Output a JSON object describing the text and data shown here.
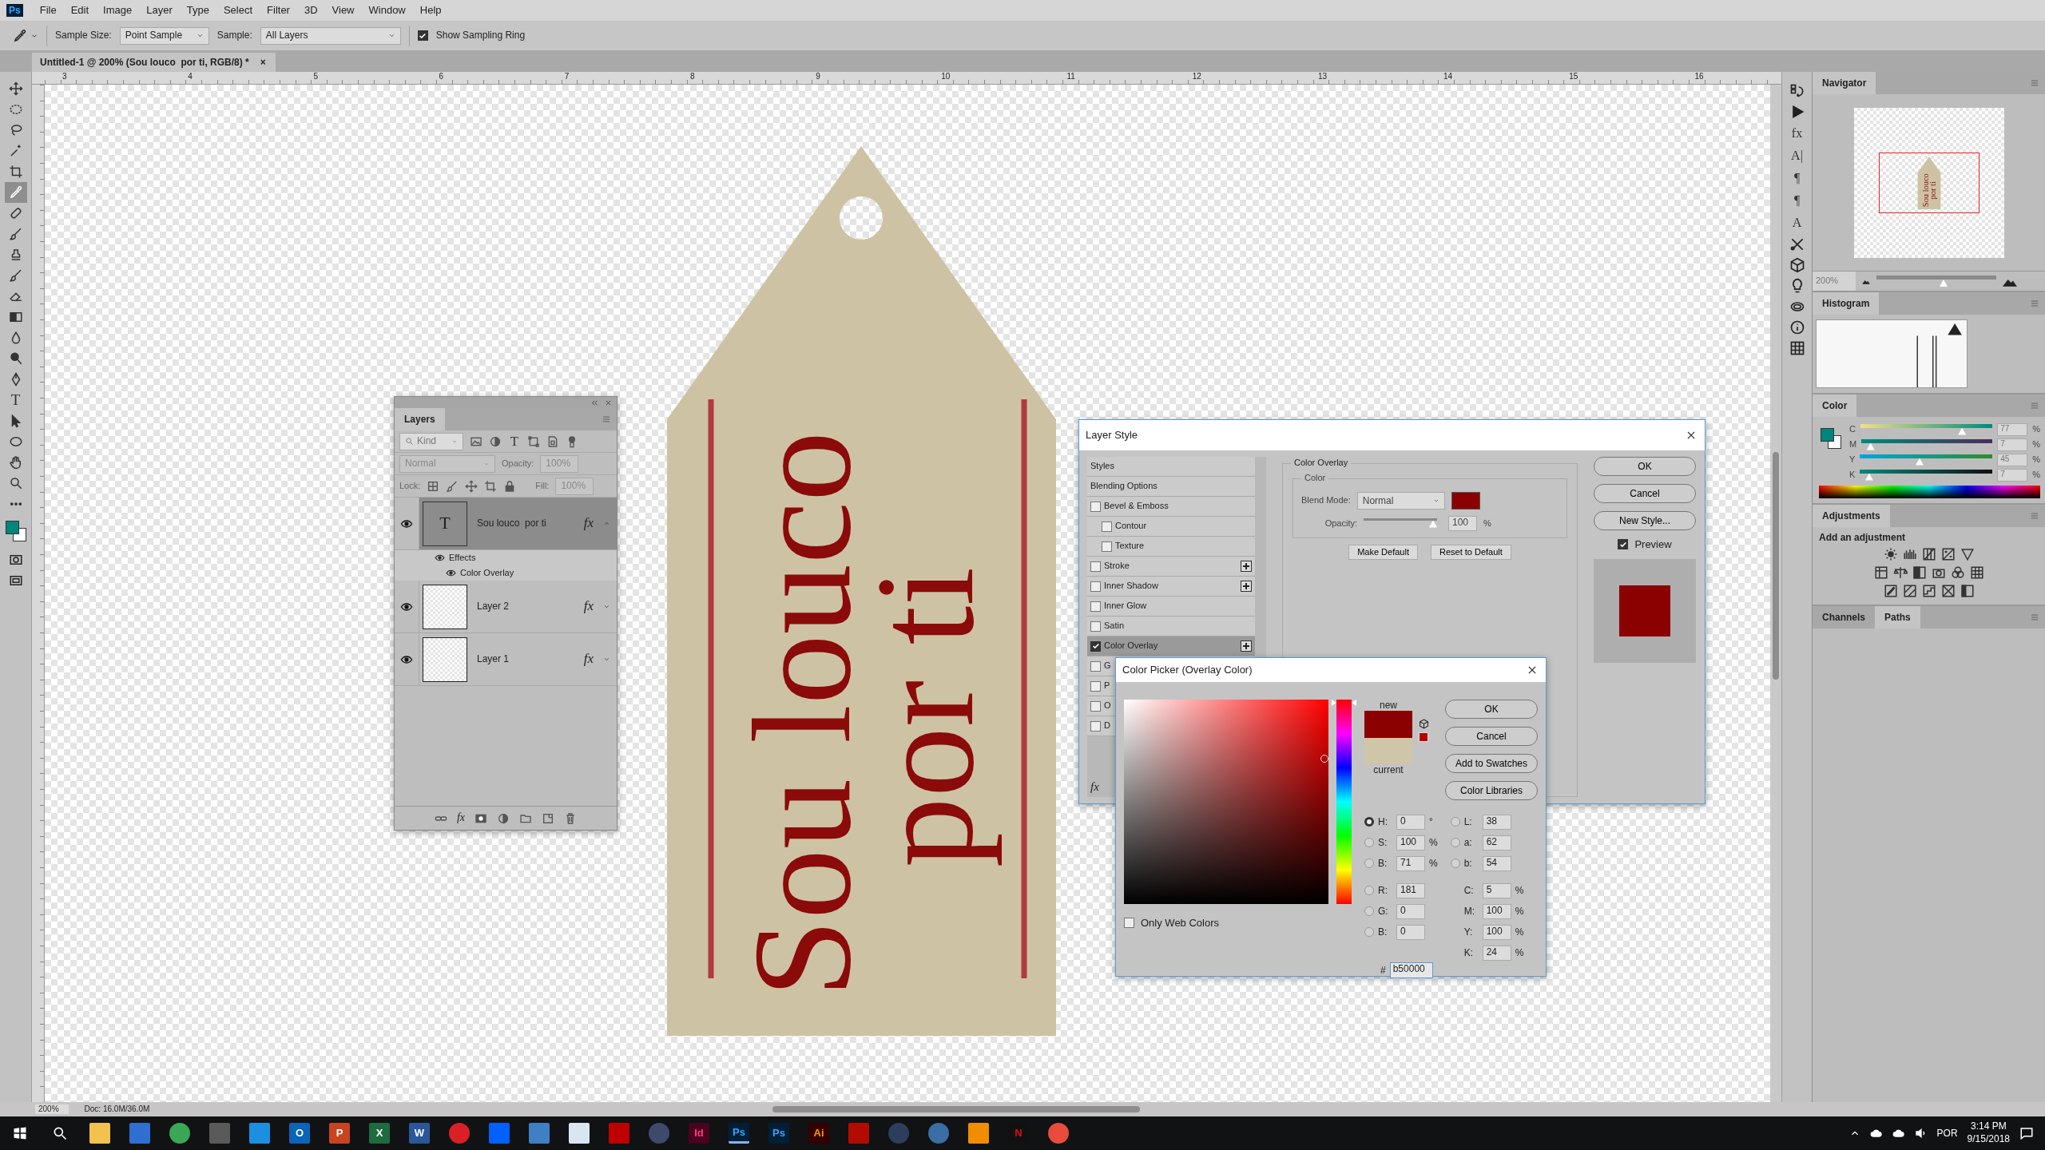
{
  "app_logo": "Ps",
  "menu": [
    "File",
    "Edit",
    "Image",
    "Layer",
    "Type",
    "Select",
    "Filter",
    "3D",
    "View",
    "Window",
    "Help"
  ],
  "options_bar": {
    "sample_size_label": "Sample Size:",
    "sample_size": "Point Sample",
    "sample_label": "Sample:",
    "sample": "All Layers",
    "sampling_ring": {
      "label": "Show Sampling Ring",
      "checked": true
    }
  },
  "document_tab": {
    "title": "Untitled-1 @ 200% (Sou louco  por ti, RGB/8) *",
    "close": "×"
  },
  "ruler_marks": [
    "3",
    "4",
    "5",
    "6",
    "7",
    "8",
    "9",
    "10",
    "11",
    "12",
    "13",
    "14",
    "15",
    "16"
  ],
  "tools": [
    {
      "kind": "move",
      "selected": false
    },
    {
      "kind": "marquee",
      "selected": false
    },
    {
      "kind": "lasso",
      "selected": false
    },
    {
      "kind": "wand",
      "selected": false
    },
    {
      "kind": "crop",
      "selected": false
    },
    {
      "kind": "eyedropper",
      "selected": true
    },
    {
      "kind": "heal",
      "selected": false
    },
    {
      "kind": "brush",
      "selected": false
    },
    {
      "kind": "stamp",
      "selected": false
    },
    {
      "kind": "brush",
      "selected": false
    },
    {
      "kind": "eraser",
      "selected": false
    },
    {
      "kind": "gradient",
      "selected": false
    },
    {
      "kind": "blur",
      "selected": false
    },
    {
      "kind": "dodge",
      "selected": false
    },
    {
      "kind": "pen",
      "selected": false
    },
    {
      "kind": "type",
      "glyph": "T",
      "selected": false
    },
    {
      "kind": "pathsel",
      "selected": false
    },
    {
      "kind": "shape",
      "selected": false
    },
    {
      "kind": "hand",
      "selected": false
    },
    {
      "kind": "zoom",
      "selected": false
    },
    {
      "kind": "more",
      "selected": false
    }
  ],
  "canvas": {
    "tag_lines": [
      "Sou louco",
      "por ti"
    ]
  },
  "status_bar": {
    "zoom": "200%",
    "doc": "Doc: 16.0M/36.0M"
  },
  "layers_panel": {
    "title": "Layers",
    "filter": "Kind",
    "filter_glyph": "T",
    "blend_mode": "Normal",
    "opacity_label": "Opacity:",
    "opacity": "100%",
    "lock_label": "Lock:",
    "fill_label": "Fill:",
    "fill": "100%",
    "fx": "fx",
    "layers": [
      {
        "name": "Sou louco  por ti",
        "kind": "text",
        "thumb_glyph": "T",
        "fx": "fx",
        "visible": true,
        "selected": true,
        "expanded": true,
        "effects_label": "Effects",
        "effects": [
          "Color Overlay"
        ]
      },
      {
        "name": "Layer 2",
        "kind": "image",
        "fx": "fx",
        "visible": true,
        "selected": false,
        "expanded": false
      },
      {
        "name": "Layer 1",
        "kind": "image",
        "fx": "fx",
        "visible": true,
        "selected": false,
        "expanded": false
      }
    ]
  },
  "layer_style": {
    "title": "Layer Style",
    "fx": "fx",
    "styles": [
      {
        "label": "Styles",
        "kind": "header",
        "selected": false
      },
      {
        "label": "Blending Options",
        "kind": "header",
        "selected": false
      },
      {
        "label": "Bevel & Emboss",
        "kind": "check",
        "checked": false,
        "add": false,
        "selected": false
      },
      {
        "label": "Contour",
        "kind": "subcheck",
        "checked": false,
        "add": false,
        "selected": false
      },
      {
        "label": "Texture",
        "kind": "subcheck",
        "checked": false,
        "add": false,
        "selected": false
      },
      {
        "label": "Stroke",
        "kind": "check",
        "checked": false,
        "add": true,
        "selected": false
      },
      {
        "label": "Inner Shadow",
        "kind": "check",
        "checked": false,
        "add": true,
        "selected": false
      },
      {
        "label": "Inner Glow",
        "kind": "check",
        "checked": false,
        "add": false,
        "selected": false
      },
      {
        "label": "Satin",
        "kind": "check",
        "checked": false,
        "add": false,
        "selected": false
      },
      {
        "label": "Color Overlay",
        "kind": "check",
        "checked": true,
        "add": true,
        "selected": true
      },
      {
        "label": "G",
        "kind": "check",
        "checked": false,
        "selected": false
      },
      {
        "label": "P",
        "kind": "check",
        "checked": false,
        "selected": false
      },
      {
        "label": "O",
        "kind": "check",
        "checked": false,
        "selected": false
      },
      {
        "label": "D",
        "kind": "check",
        "checked": false,
        "selected": false
      }
    ],
    "section_title": "Color Overlay",
    "group_title": "Color",
    "blend_label": "Blend Mode:",
    "blend_mode": "Normal",
    "opacity_label": "Opacity:",
    "opacity": "100",
    "opacity_unit": "%",
    "opacity_slider": {
      "level": 1
    },
    "action_buttons": [
      "Make Default",
      "Reset to Default"
    ],
    "side_buttons": [
      "OK",
      "Cancel",
      "New Style..."
    ],
    "preview": {
      "label": "Preview",
      "checked": true
    }
  },
  "color_picker": {
    "title": "Color Picker (Overlay Color)",
    "buttons": [
      "OK",
      "Cancel",
      "Add to Swatches",
      "Color Libraries"
    ],
    "new_label": "new",
    "current_label": "current",
    "web_colors": {
      "label": "Only Web Colors",
      "checked": false
    },
    "left_fields": [
      {
        "label": "H:",
        "value": "0",
        "unit": "°",
        "kind": "radio",
        "selected": true
      },
      {
        "label": "S:",
        "value": "100",
        "unit": "%",
        "kind": "radio",
        "selected": false
      },
      {
        "label": "B:",
        "value": "71",
        "unit": "%",
        "kind": "radio",
        "selected": false
      },
      {
        "label": "R:",
        "value": "181",
        "kind": "radio",
        "selected": false
      },
      {
        "label": "G:",
        "value": "0",
        "kind": "radio",
        "selected": false
      },
      {
        "label": "B:",
        "value": "0",
        "kind": "radio",
        "selected": false
      }
    ],
    "right_fields": [
      {
        "label": "L:",
        "value": "38",
        "kind": "radio",
        "selected": false
      },
      {
        "label": "a:",
        "value": "62",
        "kind": "radio",
        "selected": false
      },
      {
        "label": "b:",
        "value": "54",
        "kind": "radio",
        "selected": false
      },
      {
        "label": "C:",
        "value": "5",
        "unit": "%",
        "kind": "plain"
      },
      {
        "label": "M:",
        "value": "100",
        "unit": "%",
        "kind": "plain"
      },
      {
        "label": "Y:",
        "value": "100",
        "unit": "%",
        "kind": "plain"
      },
      {
        "label": "K:",
        "value": "24",
        "unit": "%",
        "kind": "plain"
      }
    ],
    "hex": {
      "label": "#",
      "value": "b50000"
    }
  },
  "side_icons": [
    {
      "kind": "history"
    },
    {
      "kind": "play"
    },
    {
      "kind": "glyph",
      "glyph": "fx"
    },
    {
      "kind": "glyph",
      "glyph": "A|"
    },
    {
      "kind": "glyph",
      "glyph": "¶"
    },
    {
      "kind": "glyph",
      "glyph": "¶"
    },
    {
      "kind": "glyph",
      "glyph": "A"
    },
    {
      "kind": "tools"
    },
    {
      "kind": "cube"
    },
    {
      "kind": "bulb"
    },
    {
      "kind": "cloud"
    },
    {
      "kind": "info"
    },
    {
      "kind": "grid"
    }
  ],
  "navigator": {
    "title": "Navigator",
    "preview_lines": [
      "Sou louco",
      "por ti"
    ],
    "zoom": "200%",
    "zoom_slider": {
      "level": 0.56
    }
  },
  "histogram": {
    "title": "Histogram"
  },
  "color_panel": {
    "title": "Color",
    "sliders": [
      {
        "label": "C",
        "value": "77",
        "unit": "%",
        "level": 0.77
      },
      {
        "label": "M",
        "value": "7",
        "unit": "%",
        "level": 0.07
      },
      {
        "label": "Y",
        "value": "45",
        "unit": "%",
        "level": 0.45
      },
      {
        "label": "K",
        "value": "7",
        "unit": "%",
        "level": 0.07
      }
    ]
  },
  "adjustments": {
    "title": "Adjustments",
    "hint": "Add an adjustment"
  },
  "bottom_tabs": [
    {
      "label": "Channels",
      "selected": false
    },
    {
      "label": "Paths",
      "selected": true
    }
  ],
  "taskbar": {
    "apps": [
      {
        "kind": "explorer",
        "color": "#f2c14e",
        "selected": false
      },
      {
        "kind": "store",
        "color": "#2f6fd1",
        "selected": false
      },
      {
        "kind": "round",
        "color": "#3aa757",
        "selected": false
      },
      {
        "kind": "plain",
        "color": "#5a5a5a",
        "selected": false
      },
      {
        "kind": "plain",
        "color": "#1d8fe0",
        "selected": false
      },
      {
        "kind": "office",
        "color": "#0a64b8",
        "label": "O",
        "selected": false
      },
      {
        "kind": "office",
        "color": "#c8441f",
        "label": "P",
        "selected": false
      },
      {
        "kind": "office",
        "color": "#1d6b3e",
        "label": "X",
        "selected": false
      },
      {
        "kind": "office",
        "color": "#2b579a",
        "label": "W",
        "selected": false
      },
      {
        "kind": "round",
        "color": "#da1f26",
        "selected": false
      },
      {
        "kind": "plain",
        "color": "#0061fe",
        "selected": false
      },
      {
        "kind": "plain",
        "color": "#3f7fc4",
        "selected": false
      },
      {
        "kind": "plain",
        "color": "#d9e6f2",
        "selected": false
      },
      {
        "kind": "plain",
        "color": "#bf0000",
        "selected": false
      },
      {
        "kind": "round",
        "color": "#3d4a6b",
        "selected": false
      },
      {
        "kind": "indesign",
        "color": "#49021f",
        "label": "Id",
        "selected": false
      },
      {
        "kind": "photoshop",
        "color": "#001e36",
        "label": "Ps",
        "selected": true
      },
      {
        "kind": "photoshop",
        "color": "#001e36",
        "label": "Ps",
        "selected": false
      },
      {
        "kind": "illustrator",
        "color": "#330000",
        "label": "Ai",
        "selected": false
      },
      {
        "kind": "plain",
        "color": "#b30b00",
        "selected": false
      },
      {
        "kind": "round",
        "color": "#2d3e5c",
        "selected": false
      },
      {
        "kind": "round",
        "color": "#3a6ea5",
        "selected": false
      },
      {
        "kind": "plain",
        "color": "#f28c00",
        "selected": false
      },
      {
        "kind": "netflix",
        "color": "#111111",
        "label": "N",
        "selected": false
      },
      {
        "kind": "round",
        "color": "#e74c3c",
        "selected": false
      }
    ],
    "language": "POR",
    "time": "3:14 PM",
    "date": "9/15/2018"
  }
}
